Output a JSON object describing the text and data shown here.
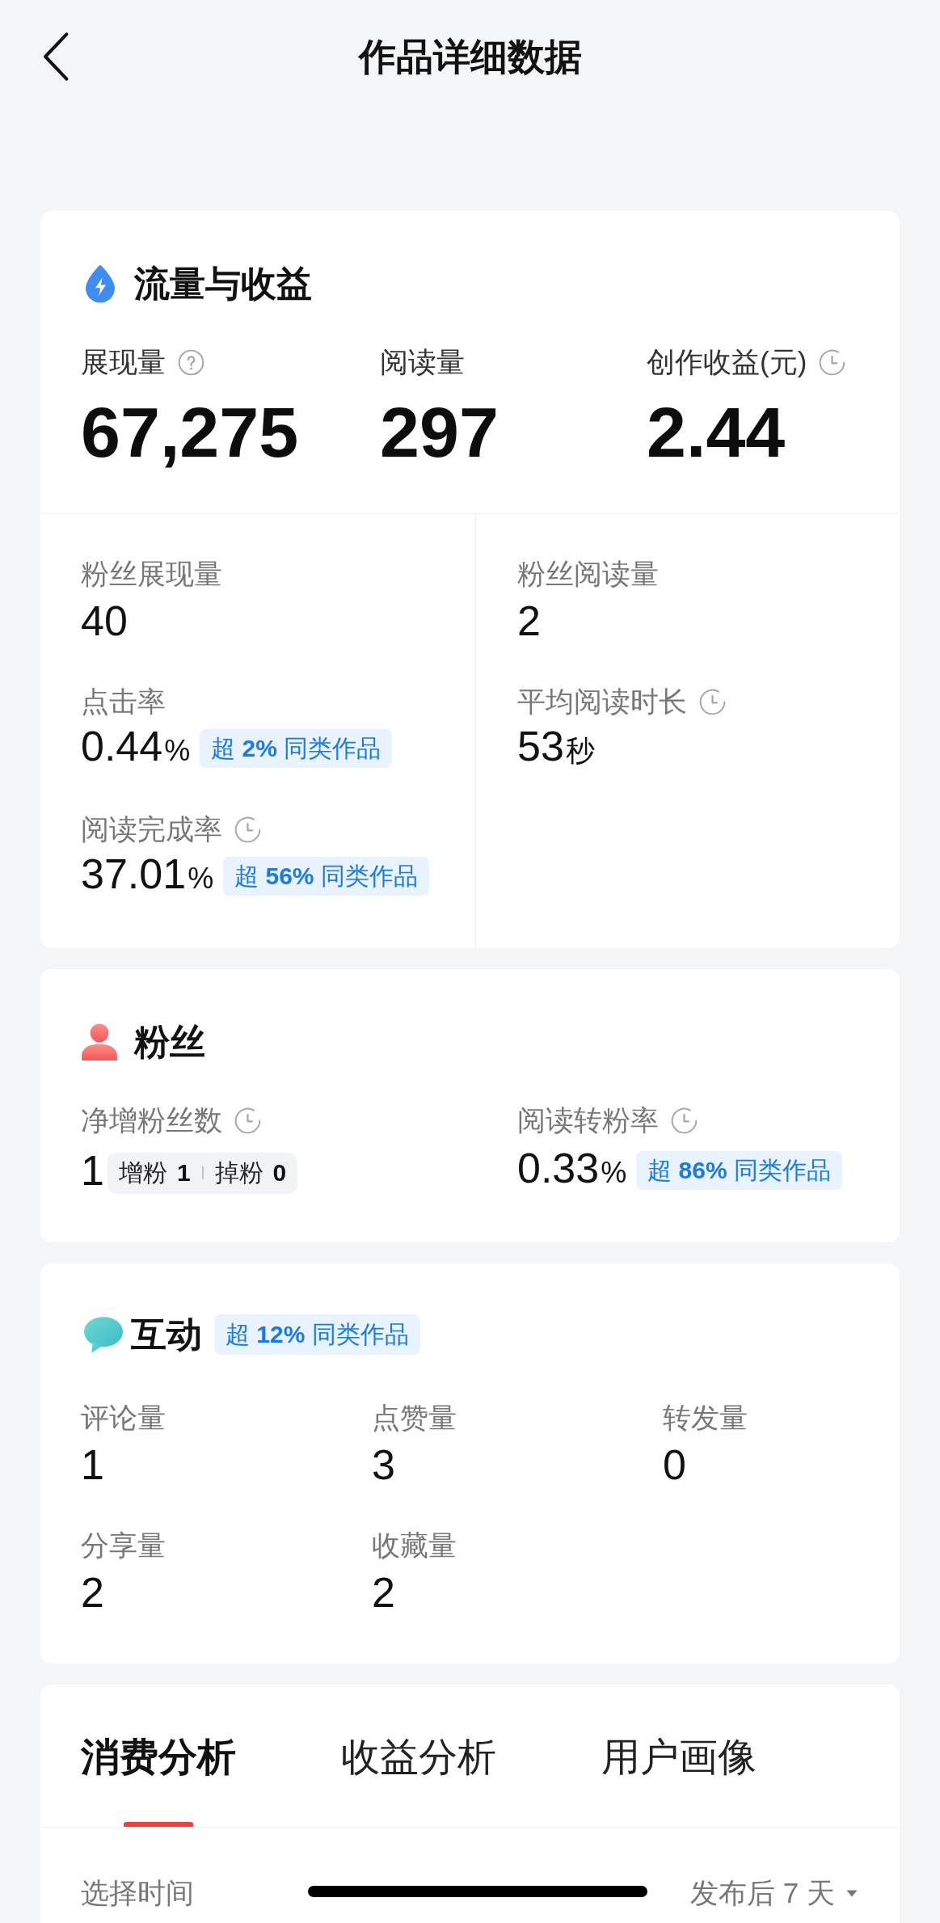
{
  "header": {
    "title": "作品详细数据"
  },
  "traffic": {
    "title": "流量与收益",
    "summary": [
      {
        "kind": "explained",
        "label": "展现量",
        "value": "67,275"
      },
      {
        "kind": "plain",
        "label": "阅读量",
        "value": "297"
      },
      {
        "kind": "delayed",
        "label": "创作收益(元)",
        "value": "2.44"
      }
    ],
    "columns": [
      {
        "items": [
          {
            "kind": "plain",
            "label": "粉丝展现量",
            "value": "40"
          },
          {
            "kind": "plain",
            "label": "点击率",
            "value": "0.44",
            "unit": "%",
            "comparison": "超 **2%** 同类作品"
          },
          {
            "kind": "delayed",
            "label": "阅读完成率",
            "value": "37.01",
            "unit": "%",
            "comparison": "超 **56%** 同类作品"
          }
        ]
      },
      {
        "items": [
          {
            "kind": "plain",
            "label": "粉丝阅读量",
            "value": "2"
          },
          {
            "kind": "delayed",
            "label": "平均阅读时长",
            "value": "53",
            "unit": "秒"
          }
        ]
      }
    ]
  },
  "fans": {
    "title": "粉丝",
    "metrics": [
      {
        "kind": "delayed",
        "label": "净增粉丝数",
        "value": "1",
        "breakdown": [
          {
            "label": "增粉",
            "value": "1"
          },
          {
            "label": "掉粉",
            "value": "0"
          }
        ]
      },
      {
        "kind": "delayed",
        "label": "阅读转粉率",
        "value": "0.33",
        "unit": "%",
        "comparison": "超 **86%** 同类作品"
      }
    ]
  },
  "interaction": {
    "title": "互动",
    "comparison": "超 **12%** 同类作品",
    "metrics": [
      {
        "label": "评论量",
        "value": "1"
      },
      {
        "label": "点赞量",
        "value": "3"
      },
      {
        "label": "转发量",
        "value": "0"
      },
      {
        "label": "分享量",
        "value": "2"
      },
      {
        "label": "收藏量",
        "value": "2"
      }
    ]
  },
  "analysis": {
    "tabs": [
      {
        "label": "消费分析",
        "selected": true
      },
      {
        "label": "收益分析",
        "selected": false
      },
      {
        "label": "用户画像",
        "selected": false
      }
    ],
    "time_filter": {
      "label": "选择时间",
      "value": "发布后 7 天"
    }
  }
}
